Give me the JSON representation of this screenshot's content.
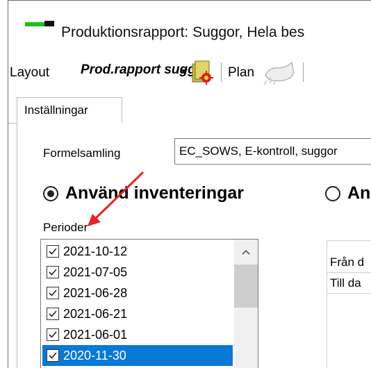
{
  "window": {
    "title": "Produktionsrapport: Suggor, Hela bes"
  },
  "toolbar": {
    "layout_label": "Layout",
    "layout_value": "Prod.rapport sugg",
    "plan_label": "Plan"
  },
  "tabs": [
    {
      "label": "Inställningar",
      "selected": true
    }
  ],
  "settings": {
    "formelsamling_label": "Formelsamling",
    "formelsamling_value": "EC_SOWS, E-kontroll, suggor",
    "radio_inventory_label": "Använd inventeringar",
    "radio_other_label": "An",
    "radio_inventory_selected": true,
    "perioder_label": "Perioder",
    "periods": [
      {
        "label": "2021-10-12",
        "checked": true,
        "selected": false
      },
      {
        "label": "2021-07-05",
        "checked": true,
        "selected": false
      },
      {
        "label": "2021-06-28",
        "checked": true,
        "selected": false
      },
      {
        "label": "2021-06-21",
        "checked": true,
        "selected": false
      },
      {
        "label": "2021-06-01",
        "checked": true,
        "selected": false
      },
      {
        "label": "2020-11-30",
        "checked": true,
        "selected": true
      }
    ]
  },
  "date_grid": {
    "rows": [
      "Från d",
      "Till da"
    ]
  },
  "colors": {
    "selection": "#0a78d6",
    "arrow": "#e8231c",
    "brand_green": "#19c21f"
  }
}
